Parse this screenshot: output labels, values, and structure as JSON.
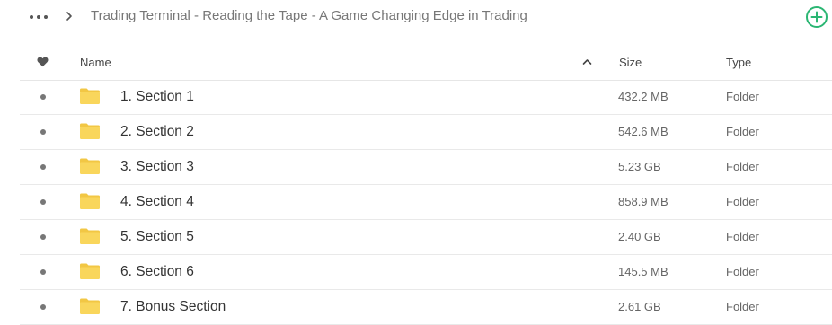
{
  "breadcrumb": {
    "path": "Trading Terminal - Reading the Tape - A Game Changing Edge in Trading"
  },
  "icons": {
    "more": "more-horizontal-icon",
    "chevron": "chevron-right-icon",
    "add": "plus-circle-icon",
    "favorite": "heart-icon",
    "sort": "chevron-up-icon",
    "folder": "folder-icon"
  },
  "colors": {
    "accent": "#2bb673",
    "folder_fill": "#f9d65c",
    "folder_tab": "#f2c744"
  },
  "columns": {
    "name": "Name",
    "size": "Size",
    "type": "Type"
  },
  "rows": [
    {
      "name": "1. Section 1",
      "size": "432.2 MB",
      "type": "Folder"
    },
    {
      "name": "2. Section 2",
      "size": "542.6 MB",
      "type": "Folder"
    },
    {
      "name": "3. Section 3",
      "size": "5.23 GB",
      "type": "Folder"
    },
    {
      "name": "4. Section 4",
      "size": "858.9 MB",
      "type": "Folder"
    },
    {
      "name": "5. Section 5",
      "size": "2.40 GB",
      "type": "Folder"
    },
    {
      "name": "6. Section 6",
      "size": "145.5 MB",
      "type": "Folder"
    },
    {
      "name": "7. Bonus Section",
      "size": "2.61 GB",
      "type": "Folder"
    }
  ]
}
